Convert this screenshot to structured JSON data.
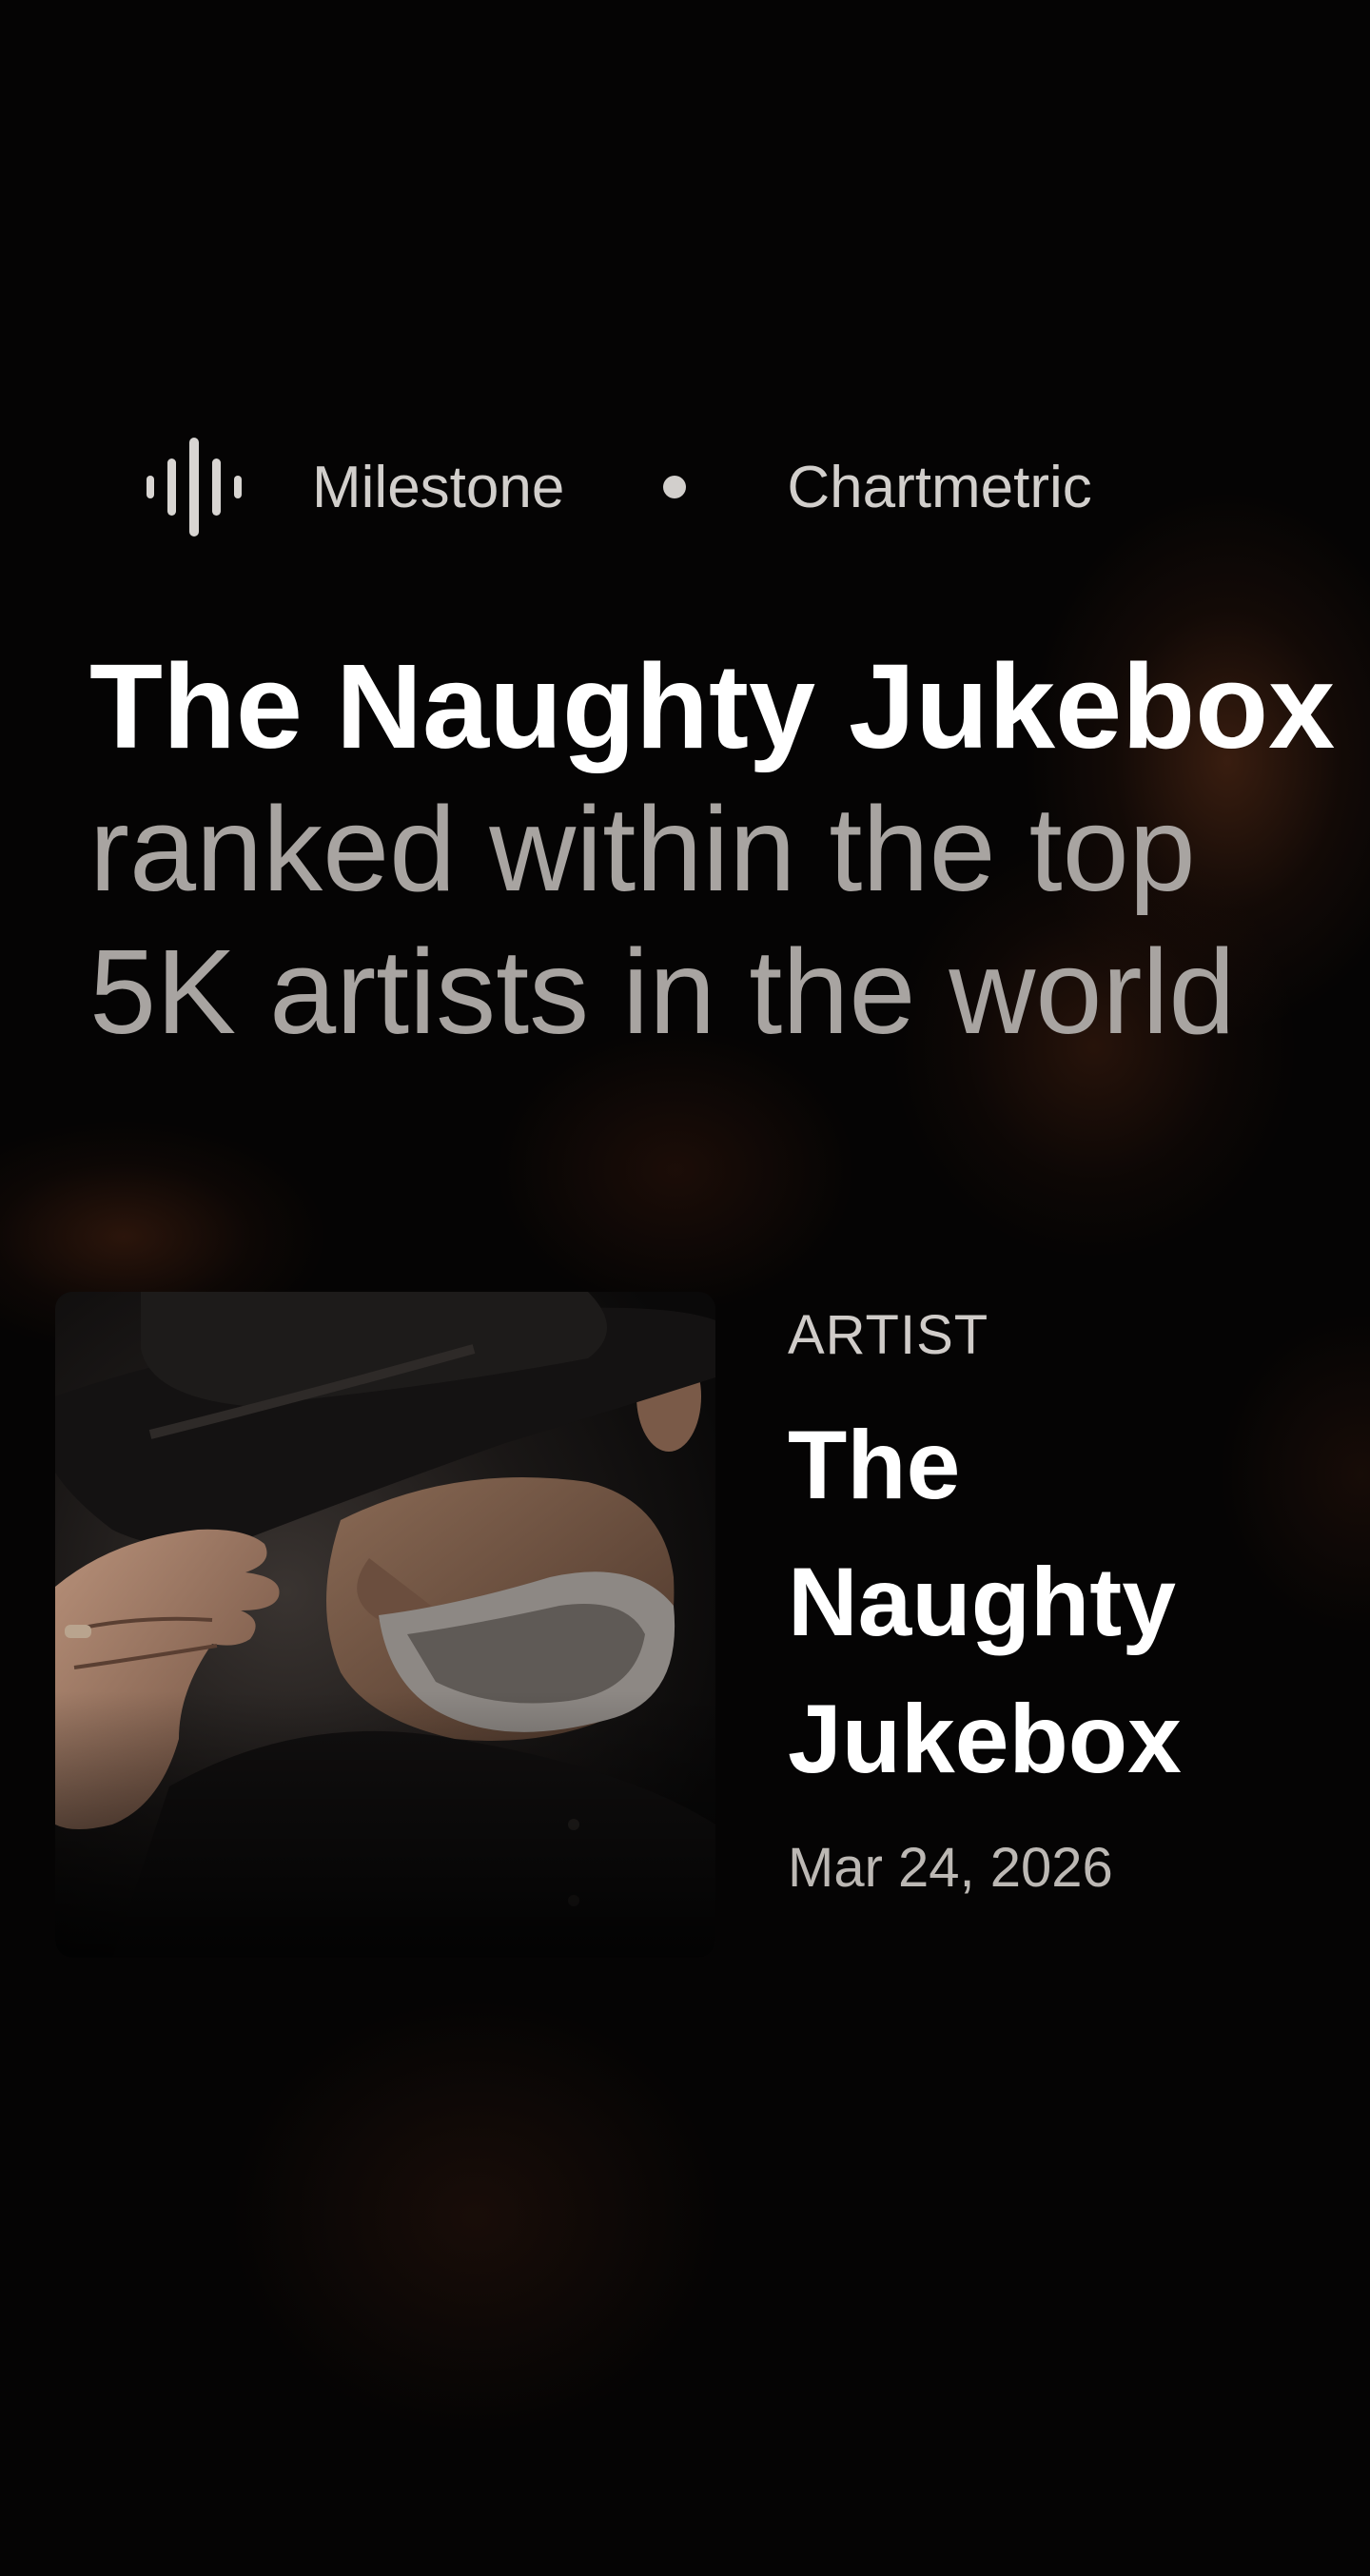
{
  "meta": {
    "category": "Milestone",
    "source": "Chartmetric",
    "category_icon": "audio-wave-icon"
  },
  "headline": {
    "artist": "The Naughty Jukebox",
    "line_1": "ranked within the top",
    "line_2": "5K artists in the world"
  },
  "artist_card": {
    "type_label": "ARTIST",
    "name_line_1": "The",
    "name_line_2": "Naughty",
    "name_line_3": "Jukebox",
    "date": "Mar 24, 2026",
    "photo_subject": "artist-photo"
  },
  "colors": {
    "background": "#050404",
    "accent_glow": "#7a3c1e",
    "text_primary": "#ffffff",
    "text_secondary": "#a8a4a1"
  }
}
